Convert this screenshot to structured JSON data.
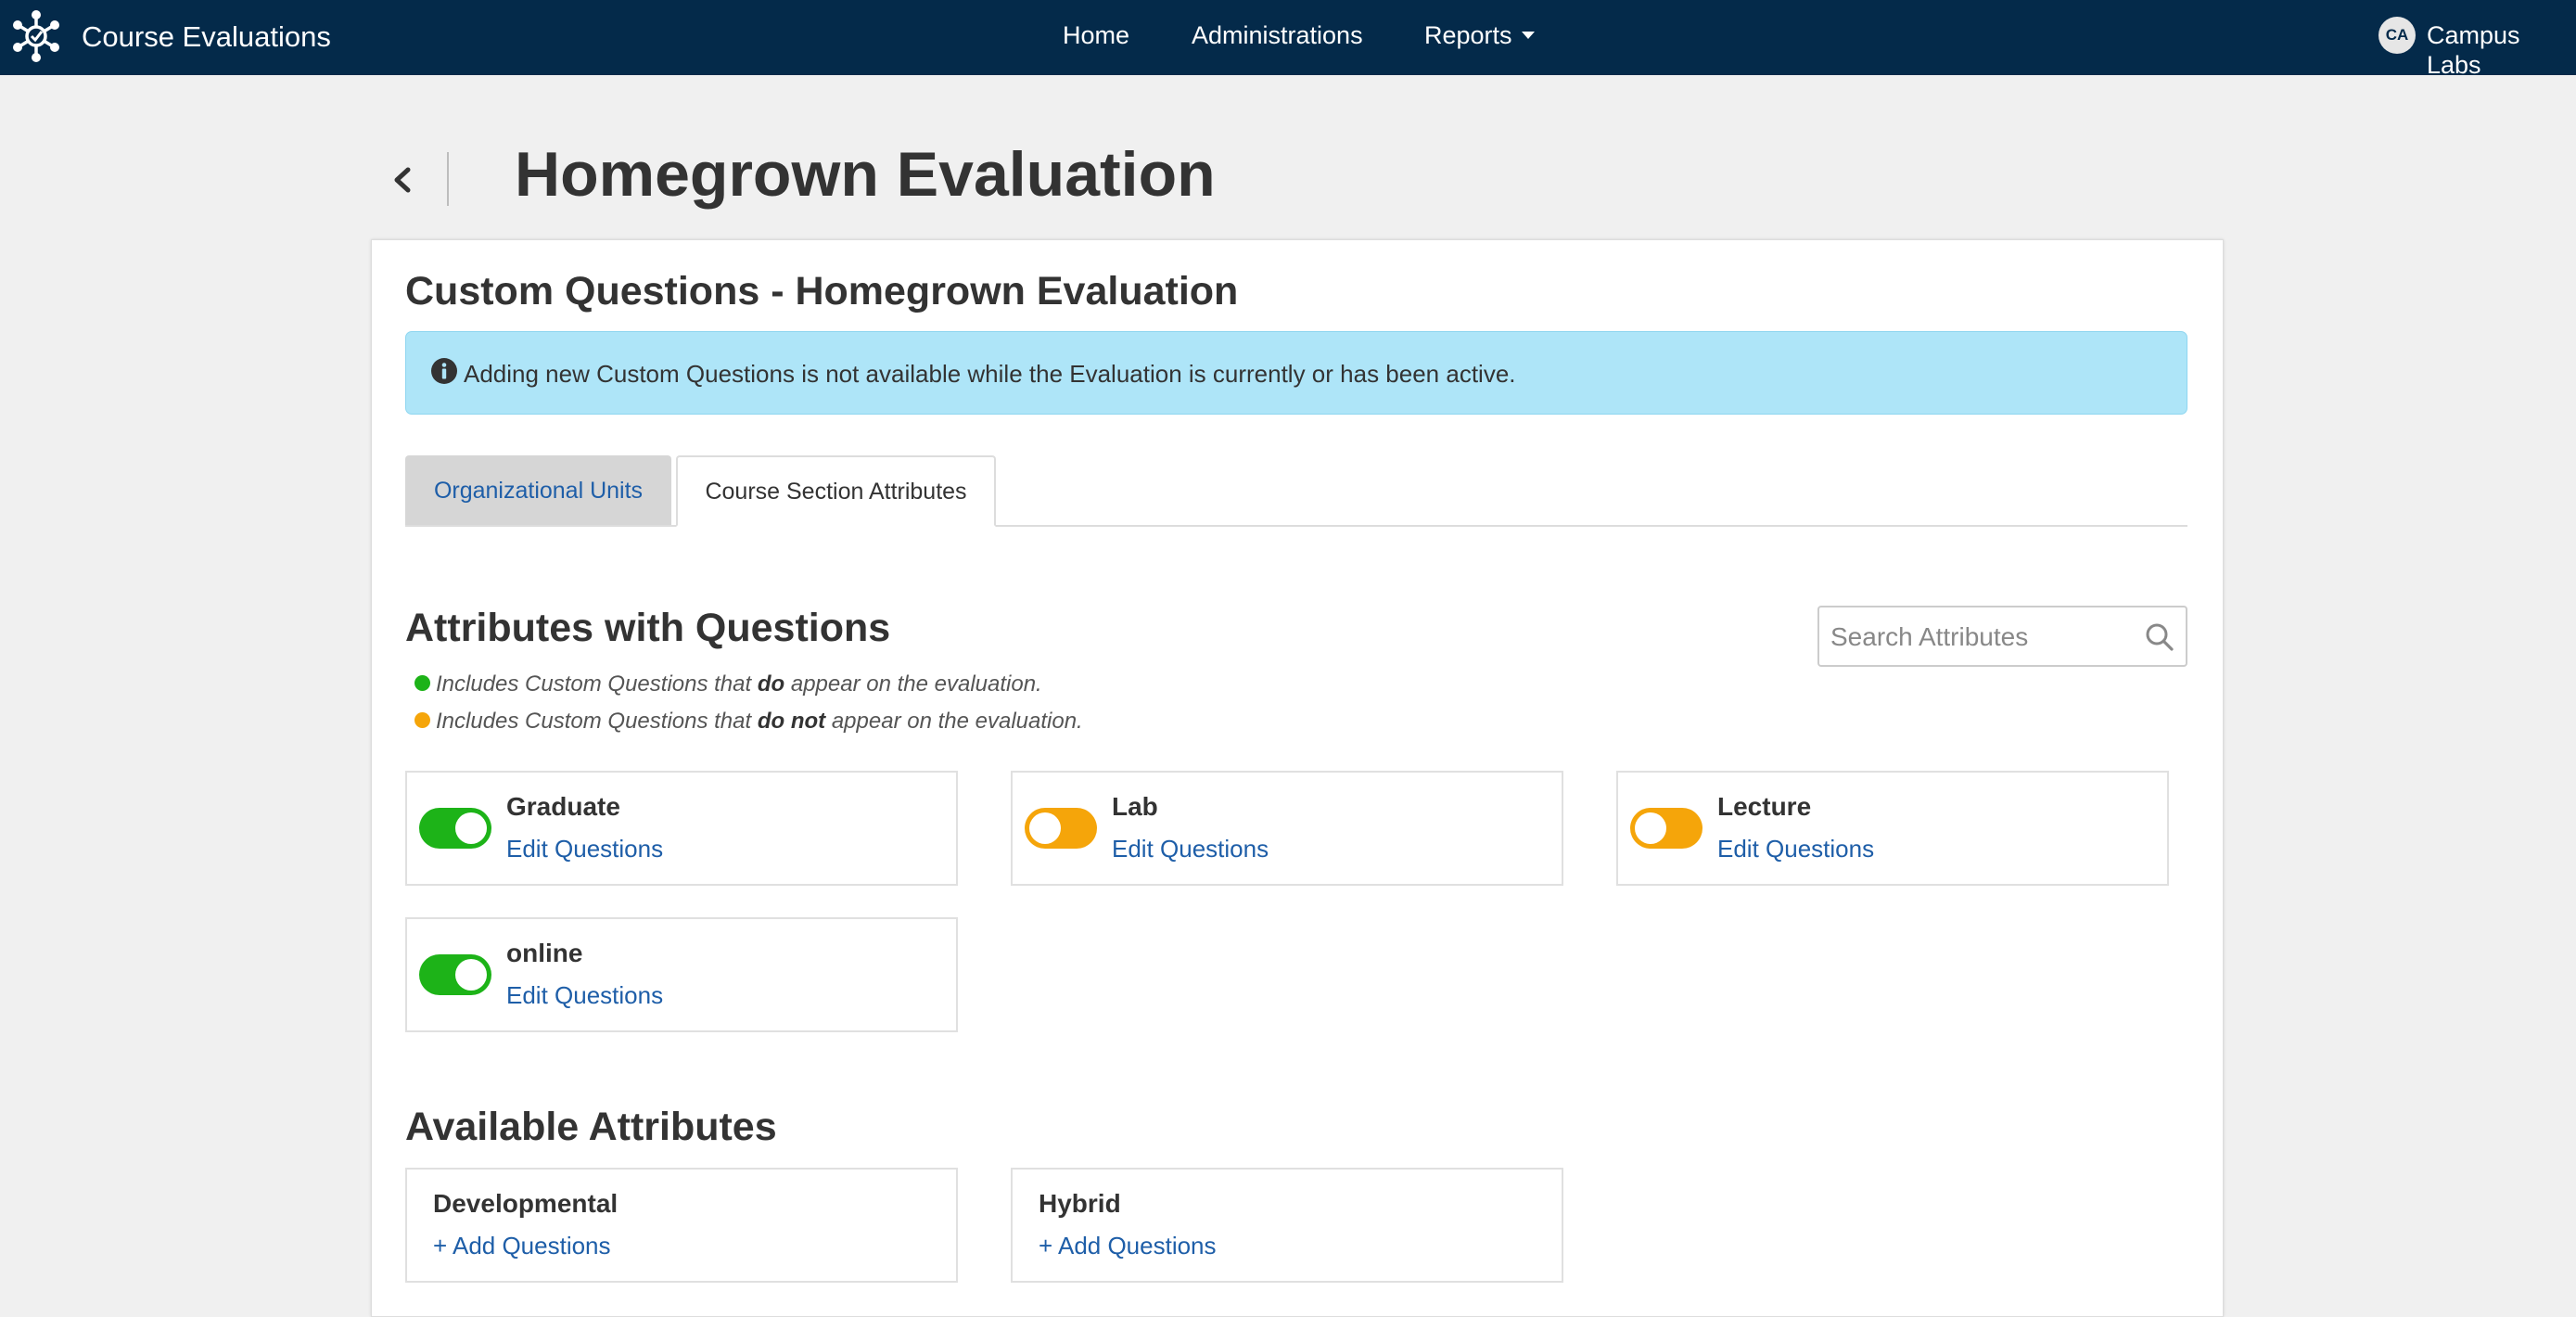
{
  "topnav": {
    "app_title": "Course Evaluations",
    "links": [
      "Home",
      "Administrations",
      "Reports"
    ],
    "user_initials": "CA",
    "user_name": "Campus Labs",
    "bg_color": "#042a4a"
  },
  "page": {
    "title": "Homegrown Evaluation"
  },
  "card": {
    "title": "Custom Questions - Homegrown Evaluation",
    "alert_text": "Adding new Custom Questions is not available while the Evaluation is currently or has been active.",
    "tabs": [
      "Organizational Units",
      "Course Section Attributes"
    ],
    "active_tab": "Course Section Attributes"
  },
  "attributes_with_questions": {
    "title": "Attributes with Questions",
    "search_placeholder": "Search Attributes",
    "legend": [
      {
        "prefix": "Includes Custom Questions that ",
        "emphasis": "do",
        "suffix": " appear on the evaluation.",
        "color": "#1db318"
      },
      {
        "prefix": "Includes Custom Questions that ",
        "emphasis": "do not",
        "suffix": " appear on the evaluation.",
        "color": "#f5a50a"
      }
    ],
    "items": [
      {
        "name": "Graduate",
        "link": "Edit Questions",
        "toggle": "on"
      },
      {
        "name": "Lab",
        "link": "Edit Questions",
        "toggle": "off"
      },
      {
        "name": "Lecture",
        "link": "Edit Questions",
        "toggle": "off"
      },
      {
        "name": "online",
        "link": "Edit Questions",
        "toggle": "on"
      }
    ]
  },
  "available_attributes": {
    "title": "Available Attributes",
    "items": [
      {
        "name": "Developmental",
        "link": "+ Add Questions"
      },
      {
        "name": "Hybrid",
        "link": "+ Add Questions"
      }
    ]
  },
  "colors": {
    "accent_link": "#1e5ea8",
    "alert_bg": "#aee5f8",
    "toggle_green": "#1db318",
    "toggle_orange": "#f5a50a"
  }
}
